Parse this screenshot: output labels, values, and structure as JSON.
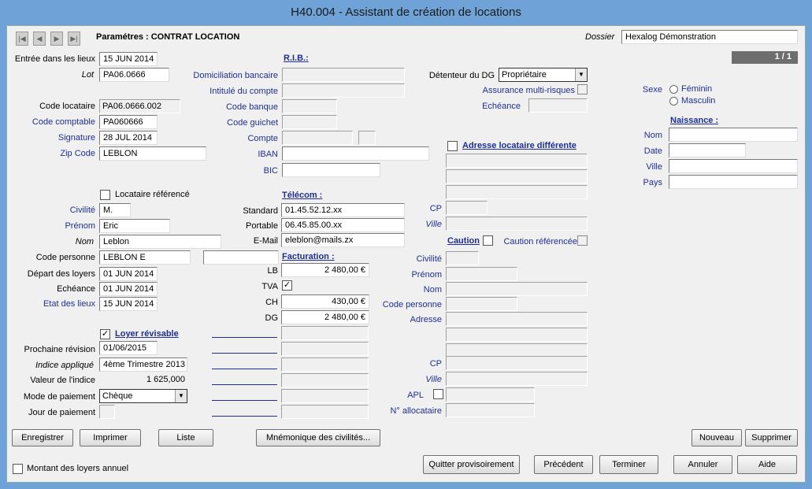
{
  "window": {
    "title": "H40.004   -   Assistant de création de locations"
  },
  "header": {
    "params": "Paramétres : CONTRAT LOCATION",
    "dossier_label": "Dossier",
    "dossier_value": "Hexalog Démonstration",
    "pager": "1 / 1"
  },
  "left": {
    "entree_label": "Entrée dans les lieux",
    "entree_value": "15 JUN 2014",
    "lot_label": "Lot",
    "lot_value": "PA06.0666",
    "code_locataire_label": "Code locataire",
    "code_locataire_value": "PA06.0666.002",
    "code_comptable_label": "Code comptable",
    "code_comptable_value": "PA060666",
    "signature_label": "Signature",
    "signature_value": "28 JUL 2014",
    "zip_label": "Zip Code",
    "zip_value": "LEBLON",
    "locataire_ref_label": "Locataire référencé",
    "civilite_label": "Civilité",
    "civilite_value": "M.",
    "prenom_label": "Prénom",
    "prenom_value": "Eric",
    "nom_label": "Nom",
    "nom_value": "Leblon",
    "code_personne_label": "Code personne",
    "code_personne_value": "LEBLON E",
    "depart_label": "Départ des loyers",
    "depart_value": "01 JUN 2014",
    "echeance_label": "Echéance",
    "echeance_value": "01 JUN 2014",
    "etat_label": "Etat des lieux",
    "etat_value": "15 JUN 2014",
    "loyer_revisable_label": "Loyer révisable",
    "prochaine_label": "Prochaine révision",
    "prochaine_value": "01/06/2015",
    "indice_label": "Indice appliqué",
    "indice_value": "4ème Trimestre 2013",
    "valeur_label": "Valeur de l'indice",
    "valeur_value": "1 625,000",
    "mode_label": "Mode de paiement",
    "mode_value": "Chèque",
    "jour_label": "Jour de paiement"
  },
  "rib": {
    "title": "R.I.B.:",
    "domiciliation": "Domiciliation bancaire",
    "intitule": "Intitulé du compte",
    "code_banque": "Code banque",
    "code_guichet": "Code guichet",
    "compte": "Compte",
    "iban": "IBAN",
    "bic": "BIC"
  },
  "telecom": {
    "title": "Télécom :",
    "standard_label": "Standard",
    "standard_value": "01.45.52.12.xx",
    "portable_label": "Portable",
    "portable_value": "06.45.85.00.xx",
    "email_label": "E-Mail",
    "email_value": "eleblon@mails.zx"
  },
  "facturation": {
    "title": "Facturation :",
    "lb_label": "LB",
    "lb_value": "2 480,00 €",
    "tva_label": "TVA",
    "ch_label": "CH",
    "ch_value": "430,00 €",
    "dg_label": "DG",
    "dg_value": "2 480,00 €"
  },
  "dg": {
    "detenteur_label": "Détenteur du DG",
    "detenteur_value": "Propriétaire",
    "assurance_label": "Assurance multi-risques",
    "echeance_label": "Echéance"
  },
  "adresse": {
    "title": "Adresse locataire différente",
    "cp_label": "CP",
    "ville_label": "Ville"
  },
  "caution": {
    "title": "Caution",
    "caution_ref_label": "Caution référencée",
    "civilite": "Civilité",
    "prenom": "Prénom",
    "nom": "Nom",
    "code_personne": "Code personne",
    "adresse": "Adresse",
    "cp": "CP",
    "ville": "Ville",
    "apl": "APL",
    "allocataire": "N° allocataire"
  },
  "naissance": {
    "sexe_label": "Sexe",
    "feminin": "Féminin",
    "masculin": "Masculin",
    "title": "Naissance :",
    "nom": "Nom",
    "date": "Date",
    "ville": "Ville",
    "pays": "Pays"
  },
  "buttons": {
    "enregistrer": "Enregistrer",
    "imprimer": "Imprimer",
    "liste": "Liste",
    "mnemonique": "Mnémonique des civilités...",
    "nouveau": "Nouveau",
    "supprimer": "Supprimer",
    "quitter": "Quitter provisoirement",
    "precedent": "Précédent",
    "terminer": "Terminer",
    "annuler": "Annuler",
    "aide": "Aide"
  },
  "footer": {
    "montant_label": "Montant des loyers annuel"
  }
}
